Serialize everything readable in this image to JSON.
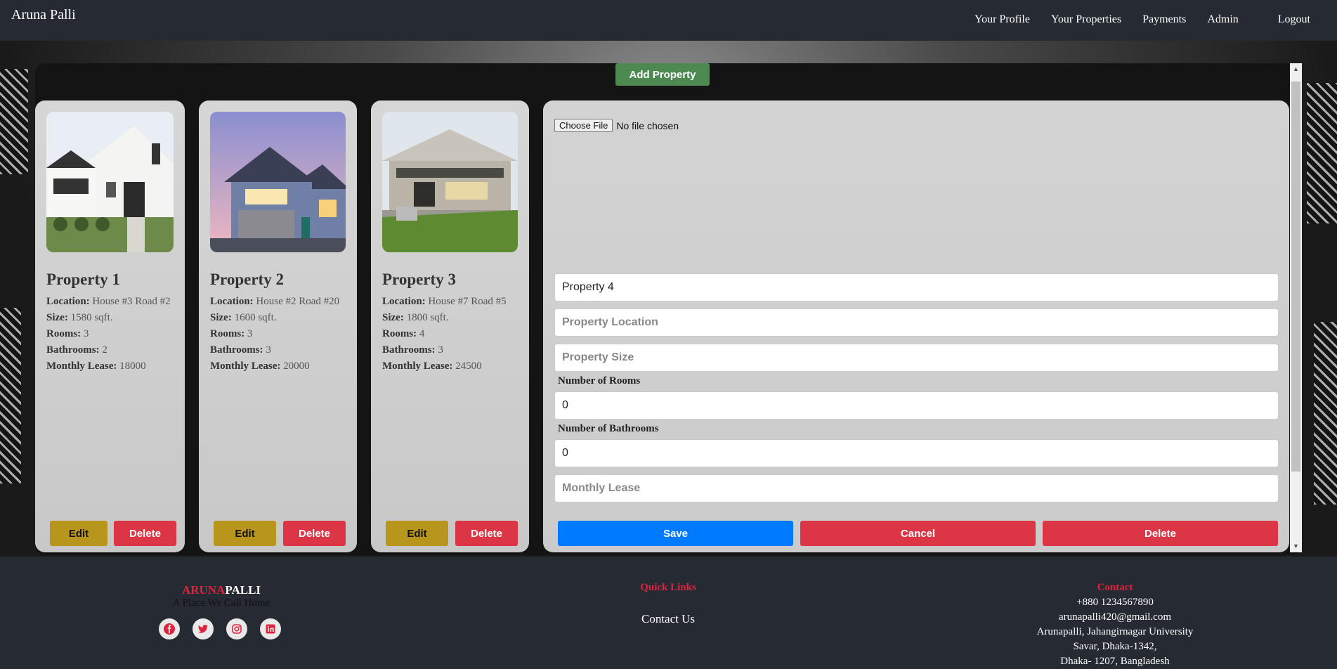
{
  "navbar": {
    "brand": "Aruna Palli",
    "links": [
      "Your Profile",
      "Your Properties",
      "Payments",
      "Admin",
      "Logout"
    ]
  },
  "main": {
    "add_property_label": "Add Property",
    "properties": [
      {
        "title": "Property 1",
        "location": "House #3 Road #2",
        "size": "1580 sqft.",
        "rooms": "3",
        "bathrooms": "2",
        "lease": "18000"
      },
      {
        "title": "Property 2",
        "location": "House #2 Road #20",
        "size": "1600 sqft.",
        "rooms": "3",
        "bathrooms": "3",
        "lease": "20000"
      },
      {
        "title": "Property 3",
        "location": "House #7 Road #5",
        "size": "1800 sqft.",
        "rooms": "4",
        "bathrooms": "3",
        "lease": "24500"
      }
    ],
    "labels": {
      "location": "Location:",
      "size": "Size:",
      "rooms": "Rooms:",
      "bathrooms": "Bathrooms:",
      "lease": "Monthly Lease:"
    },
    "edit_label": "Edit",
    "delete_label": "Delete"
  },
  "form": {
    "file_button": "Choose File",
    "file_status": "No file chosen",
    "name_value": "Property 4",
    "location_placeholder": "Property Location",
    "size_placeholder": "Property Size",
    "rooms_label": "Number of Rooms",
    "rooms_value": "0",
    "bathrooms_label": "Number of Bathrooms",
    "bathrooms_value": "0",
    "lease_placeholder": "Monthly Lease",
    "save_label": "Save",
    "cancel_label": "Cancel",
    "delete_label": "Delete"
  },
  "footer": {
    "brand_red": "ARUNA",
    "brand_white": "PALLI",
    "tagline": "A Place We Call Home",
    "socials": [
      "facebook-icon",
      "twitter-icon",
      "instagram-icon",
      "linkedin-icon"
    ],
    "quick_links_title": "Quick Links",
    "contact_us": "Contact Us",
    "contact_title": "Contact",
    "contact_lines": [
      "+880 1234567890",
      "arunapalli420@gmail.com",
      "Arunapalli, Jahangirnagar University",
      "Savar, Dhaka-1342,",
      "Dhaka- 1207, Bangladesh"
    ]
  },
  "colors": {
    "accent_green": "#4d8a51",
    "edit_gold": "#b8961e",
    "danger_red": "#dc3545",
    "save_blue": "#007bff",
    "brand_red": "#e0233d"
  }
}
